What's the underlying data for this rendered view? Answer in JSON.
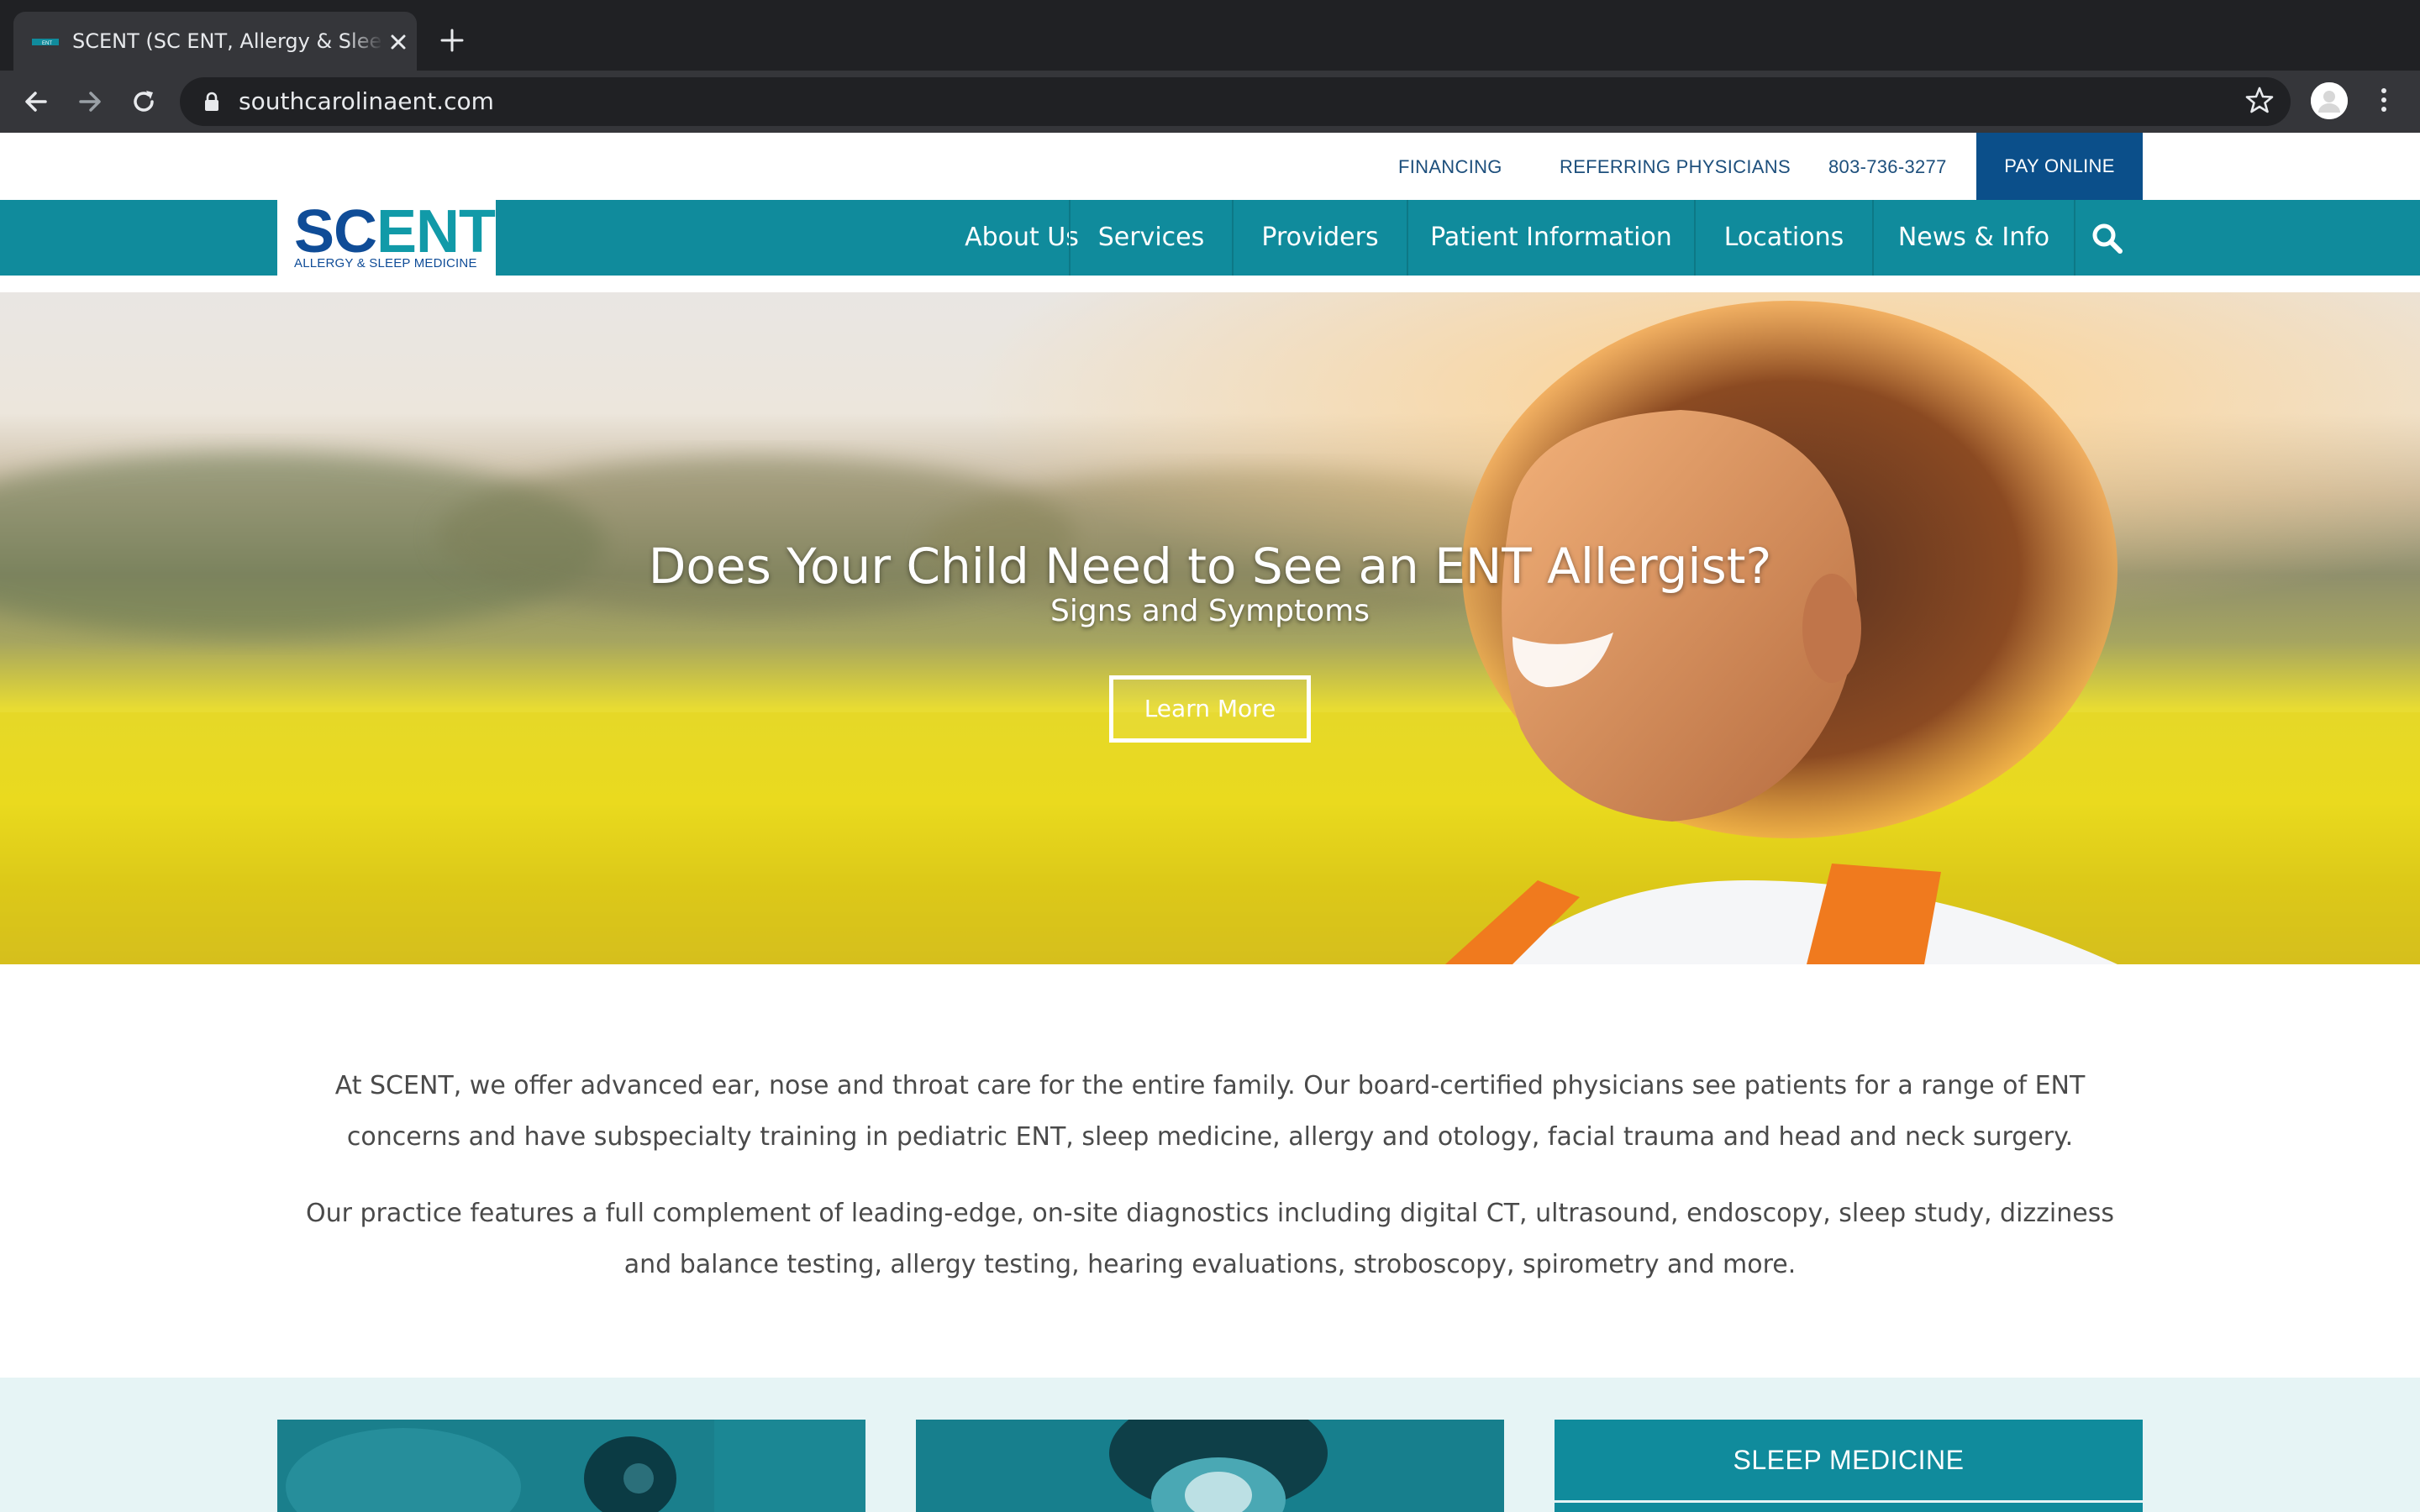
{
  "browser": {
    "tab_title": "SCENT (SC ENT, Allergy & Sleep Medicine)",
    "url": "southcarolinaent.com"
  },
  "utility_nav": {
    "financing": "FINANCING",
    "referring": "REFERRING PHYSICIANS",
    "phone": "803-736-3277",
    "pay_online": "PAY ONLINE"
  },
  "logo": {
    "sc": "SC",
    "ent": "ENT",
    "subtitle": "ALLERGY & SLEEP MEDICINE"
  },
  "main_nav": [
    {
      "label": "About Us"
    },
    {
      "label": "Services"
    },
    {
      "label": "Providers"
    },
    {
      "label": "Patient Information"
    },
    {
      "label": "Locations"
    },
    {
      "label": "News & Info"
    }
  ],
  "hero": {
    "title": "Does Your Child Need to See an ENT Allergist?",
    "subtitle": "Signs and Symptoms",
    "button": "Learn More"
  },
  "intro": {
    "p1": "At SCENT, we offer advanced ear, nose and throat care for the entire family. Our board-certified physicians see patients for a range of ENT concerns and have subspecialty training in pediatric ENT, sleep medicine, allergy and otology, facial trauma and head and neck surgery.",
    "p2": "Our practice features a full complement of leading-edge, on-site diagnostics including digital CT, ultrasound, endoscopy, sleep study, dizziness and balance testing, allergy testing, hearing evaluations, stroboscopy, spirometry and more."
  },
  "cards": {
    "sleep_medicine": "SLEEP MEDICINE"
  },
  "colors": {
    "teal": "#108b9c",
    "navy": "#0b4f8a",
    "logo_blue": "#0f4c97"
  }
}
